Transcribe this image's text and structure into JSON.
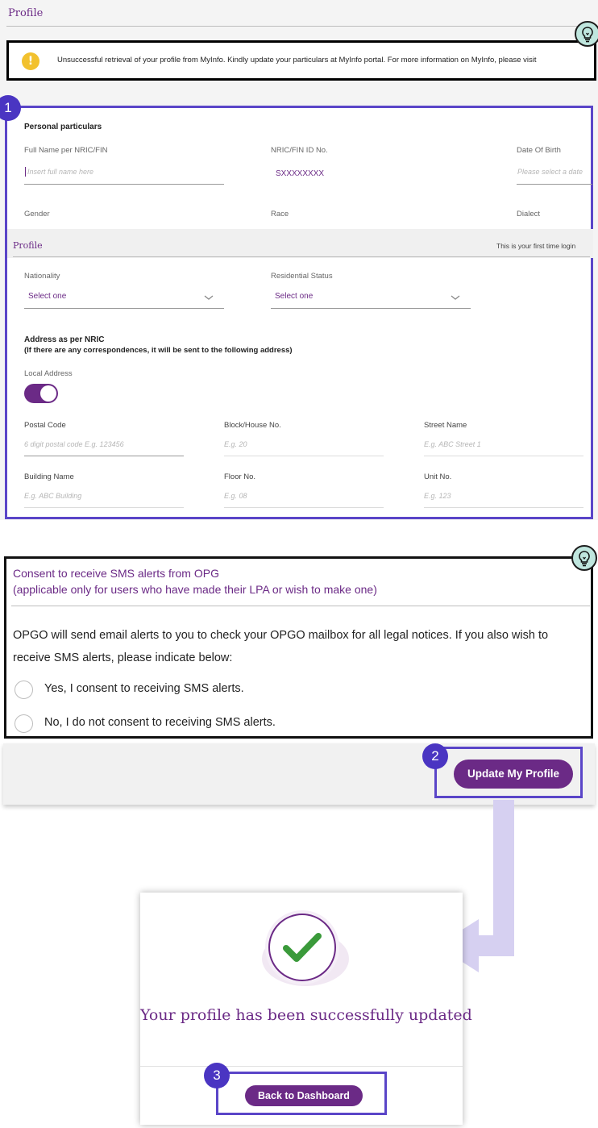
{
  "header": {
    "title": "Profile"
  },
  "warning": {
    "icon": "exclamation-icon",
    "text": "Unsuccessful retrieval of your profile from MyInfo. Kindly update your particulars at MyInfo portal. For more information on MyInfo, please visit"
  },
  "hint_icon": "lightbulb-icon",
  "steps": {
    "one": "1",
    "two": "2",
    "three": "3"
  },
  "personal": {
    "heading": "Personal particulars",
    "full_name_label": "Full Name per NRIC/FIN",
    "full_name_placeholder": "Insert full name here",
    "nric_label": "NRIC/FIN ID No.",
    "nric_value": "SXXXXXXXX",
    "dob_label": "Date Of Birth",
    "dob_placeholder": "Please select a date",
    "gender_label": "Gender",
    "race_label": "Race",
    "dialect_label": "Dialect"
  },
  "inner_profile": {
    "title": "Profile",
    "notice": "This is your first time login"
  },
  "nationality": {
    "label": "Nationality",
    "value": "Select one"
  },
  "residential": {
    "label": "Residential Status",
    "value": "Select one"
  },
  "address": {
    "heading": "Address as per NRIC",
    "subheading": "(If there are any correspondences, it will be sent to the following address)",
    "local_label": "Local Address",
    "local_enabled": true,
    "postal_label": "Postal Code",
    "postal_placeholder": "6 digit postal code E.g. 123456",
    "block_label": "Block/House No.",
    "block_placeholder": "E.g. 20",
    "street_label": "Street Name",
    "street_placeholder": "E.g. ABC Street 1",
    "building_label": "Building Name",
    "building_placeholder": "E.g. ABC Building",
    "floor_label": "Floor No.",
    "floor_placeholder": "E.g. 08",
    "unit_label": "Unit No.",
    "unit_placeholder": "E.g. 123"
  },
  "consent": {
    "title": "Consent to receive SMS alerts from OPG",
    "subtitle": "(applicable only for users who have made their LPA or wish to make one)",
    "description": "OPGO will send email alerts to you to check your OPGO mailbox for all legal notices. If you also wish to receive SMS alerts, please indicate below:",
    "yes_label": "Yes, I consent to receiving SMS alerts.",
    "no_label": "No, I do not consent to receiving SMS alerts."
  },
  "update_button": "Update My Profile",
  "success": {
    "message": "Your profile has been successfully updated",
    "button": "Back to Dashboard"
  },
  "colors": {
    "brand_purple": "#6b2a86",
    "highlight_blue": "#5a45c8",
    "warning_yellow": "#f2c12e",
    "success_green": "#3a9a3a"
  }
}
